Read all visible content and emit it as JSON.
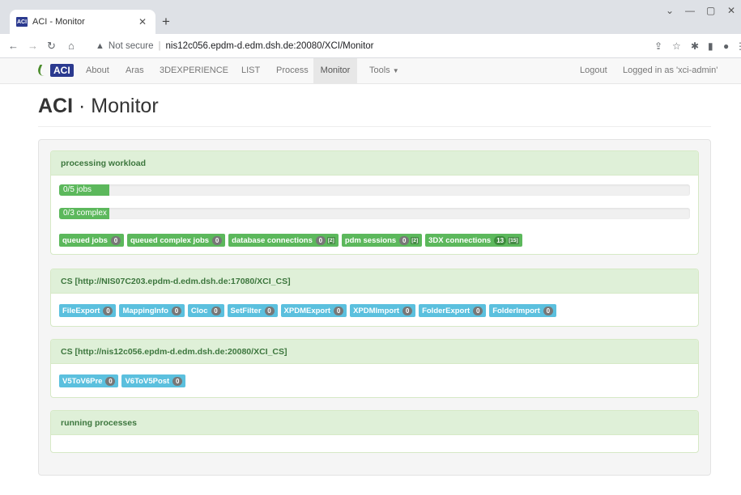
{
  "browser": {
    "tab_title": "ACI - Monitor",
    "favicon_text": "ACI",
    "security_warning": "Not secure",
    "url": "nis12c056.epdm-d.edm.dsh.de:20080/XCI/Monitor"
  },
  "nav": {
    "logo_text": "ACI",
    "items": [
      "About",
      "Aras",
      "3DEXPERIENCE",
      "LIST",
      "Process",
      "Monitor"
    ],
    "active_item": "Monitor",
    "tools": "Tools",
    "logout": "Logout",
    "logged_in": "Logged in as 'xci-admin'"
  },
  "page": {
    "title_bold": "ACI",
    "title_sep": " · ",
    "title_rest": "Monitor"
  },
  "workload": {
    "heading": "processing workload",
    "jobs": {
      "text": "0/5 jobs",
      "fraction": 0.08
    },
    "complex": {
      "text": "0/3 complex",
      "fraction": 0.08
    },
    "labels": [
      {
        "text": "queued jobs",
        "count": "0"
      },
      {
        "text": "queued complex jobs",
        "count": "0"
      },
      {
        "text": "database connections",
        "count": "0",
        "limit": "[2]"
      },
      {
        "text": "pdm sessions",
        "count": "0",
        "limit": "[2]"
      },
      {
        "text": "3DX connections",
        "count": "13",
        "limit": "[15]"
      }
    ]
  },
  "cs1": {
    "heading": "CS [http://NIS07C203.epdm-d.edm.dsh.de:17080/XCI_CS]",
    "labels": [
      {
        "text": "FileExport",
        "count": "0"
      },
      {
        "text": "MappingInfo",
        "count": "0"
      },
      {
        "text": "Cloc",
        "count": "0"
      },
      {
        "text": "SetFilter",
        "count": "0"
      },
      {
        "text": "XPDMExport",
        "count": "0"
      },
      {
        "text": "XPDMImport",
        "count": "0"
      },
      {
        "text": "FolderExport",
        "count": "0"
      },
      {
        "text": "FolderImport",
        "count": "0"
      }
    ]
  },
  "cs2": {
    "heading": "CS [http://nis12c056.epdm-d.edm.dsh.de:20080/XCI_CS]",
    "labels": [
      {
        "text": "V5ToV6Pre",
        "count": "0"
      },
      {
        "text": "V6ToV5Post",
        "count": "0"
      }
    ]
  },
  "running": {
    "heading": "running processes"
  },
  "colors": {
    "success": "#5cb85c",
    "info": "#5bc0de",
    "panel_heading_bg": "#dff0d8",
    "panel_heading_text": "#3c763d",
    "logo_blue": "#2b3a8f"
  }
}
